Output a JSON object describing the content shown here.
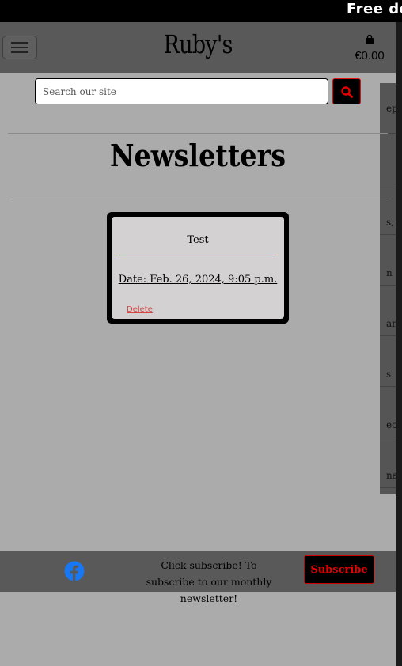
{
  "banner": {
    "text": "Free delivery"
  },
  "header": {
    "logo": "Ruby's",
    "cart_total": "€0.00"
  },
  "search": {
    "placeholder": "Search our site"
  },
  "page": {
    "title": "Newsletters"
  },
  "newsletter_card": {
    "title": "Test",
    "date": "Date: Feb. 26, 2024, 9:05 p.m.",
    "delete_label": "Delete"
  },
  "side_panel": {
    "items": [
      "ep",
      "s,",
      "n",
      "an",
      "s",
      "ec",
      "na"
    ]
  },
  "footer": {
    "text": "Click subscribe! To subscribe to our monthly newsletter!",
    "subscribe_label": "Subscribe"
  },
  "colors": {
    "accent": "#e40000",
    "facebook": "#1877f2",
    "header_bg": "#595959",
    "page_bg": "#ababab"
  }
}
